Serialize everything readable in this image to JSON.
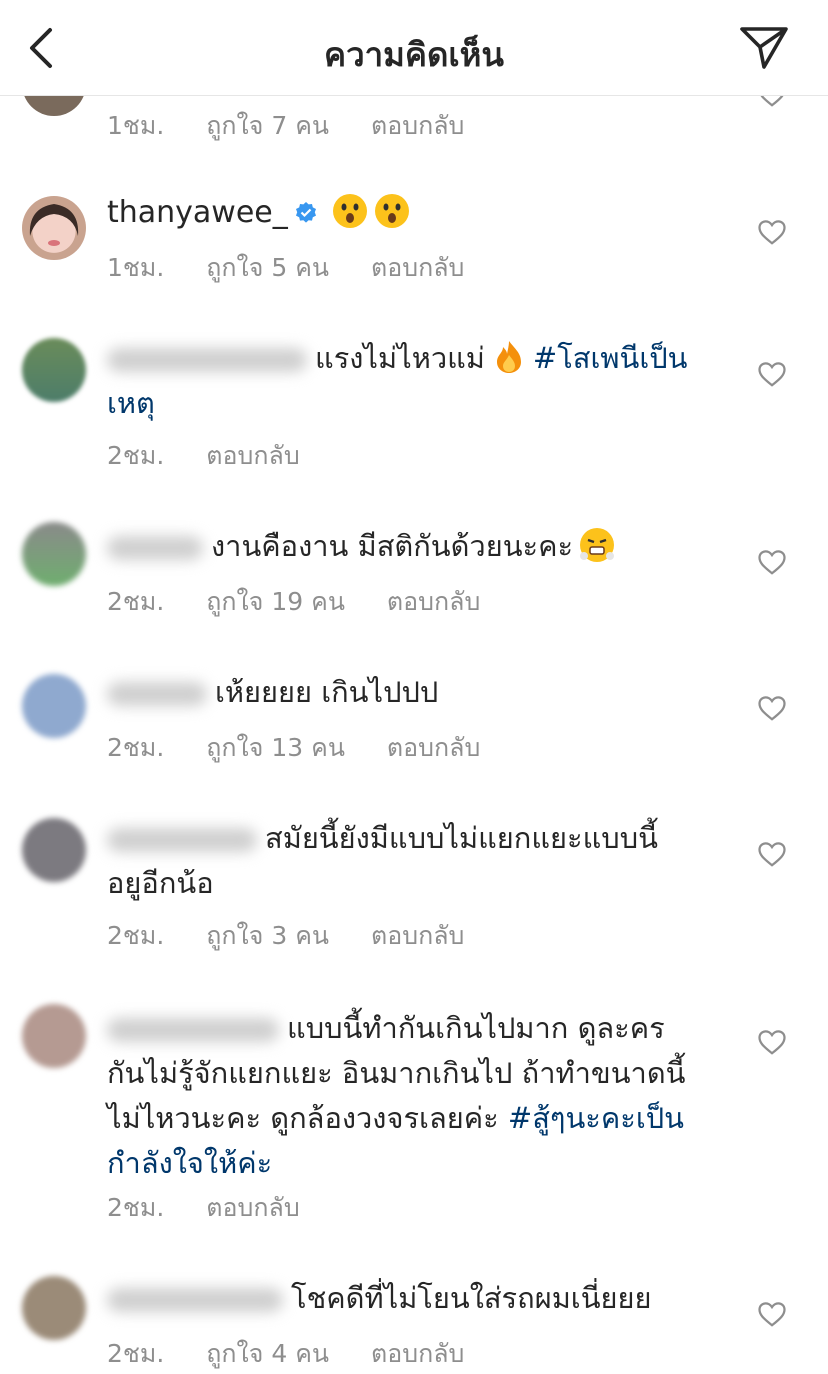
{
  "header": {
    "title": "ความคิดเห็น"
  },
  "comments": [
    {
      "meta": {
        "time": "1ชม.",
        "likes": "ถูกใจ 7 คน",
        "reply": "ตอบกลับ"
      }
    },
    {
      "username": "thanyawee_",
      "verified": true,
      "text": "",
      "meta": {
        "time": "1ชม.",
        "likes": "ถูกใจ 5 คน",
        "reply": "ตอบกลับ"
      }
    },
    {
      "text": "แรงไม่ไหวแม่",
      "hashtag": "#โสเพนีเป็น",
      "text2": "เหตุ",
      "meta": {
        "time": "2ชม.",
        "reply": "ตอบกลับ"
      }
    },
    {
      "text": "งานคืองาน มีสติกันด้วยนะคะ",
      "meta": {
        "time": "2ชม.",
        "likes": "ถูกใจ 19 คน",
        "reply": "ตอบกลับ"
      }
    },
    {
      "text": "เห้ยยยย เกินไปปป",
      "meta": {
        "time": "2ชม.",
        "likes": "ถูกใจ 13 คน",
        "reply": "ตอบกลับ"
      }
    },
    {
      "text": "สมัยนี้ยังมีแบบไม่แยกแยะแบบนี้",
      "text2": "อยูอีกน้อ",
      "meta": {
        "time": "2ชม.",
        "likes": "ถูกใจ 3 คน",
        "reply": "ตอบกลับ"
      }
    },
    {
      "text": "แบบนี้ทำกันเกินไปมาก ดูละคร",
      "text2": "กันไม่รู้จักแยกแยะ อินมากเกินไป ถ้าทำขนาดนี้",
      "text3": "ไม่ไหวนะคะ ดูกล้องวงจรเลยค่ะ",
      "hashtag": "#สู้ๆนะคะเป็น",
      "hashtag2": "กำลังใจให้ค่ะ",
      "meta": {
        "time": "2ชม.",
        "reply": "ตอบกลับ"
      }
    },
    {
      "text": "โชคดีที่ไม่โยนใส่รถผมเนี่ยยย",
      "meta": {
        "time": "2ชม.",
        "likes": "ถูกใจ 4 คน",
        "reply": "ตอบกลับ"
      }
    }
  ],
  "colors": {
    "text": "#262626",
    "secondary": "#8e8e8e",
    "hashtag": "#00376b",
    "verified": "#3897f0"
  },
  "icons": [
    "back-icon",
    "direct-send-icon",
    "heart-icon",
    "verified-badge-icon",
    "hushed-face-emoji",
    "fire-emoji",
    "steam-face-emoji"
  ]
}
